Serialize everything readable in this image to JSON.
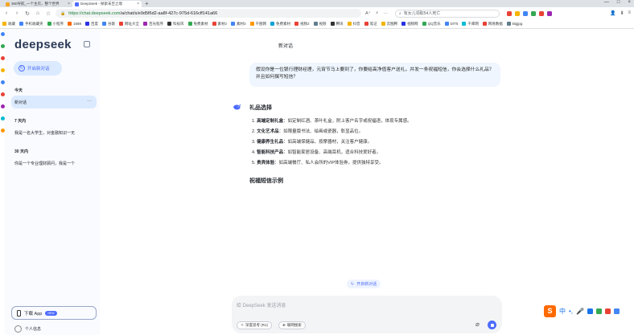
{
  "browser": {
    "tabs": [
      {
        "title": "360导航_一个主页，整个世界",
        "active": false,
        "color": "#f5a623"
      },
      {
        "title": "DeepSeek - 探索未至之境",
        "active": true,
        "color": "#4d6bfe"
      }
    ],
    "new_tab": "+",
    "window_controls": [
      "—",
      "□",
      "×"
    ],
    "nav": {
      "back": "‹",
      "forward": "›",
      "reload": "↻",
      "home": "⌂",
      "star": "☆"
    },
    "url": {
      "scheme": "https://",
      "host": "chat.deepseek.com",
      "path": "/a/chat/s/e9d5f6d2-aa8f-427c-975d-616cff141a66"
    },
    "url_tools": [
      "A⁺",
      "⚡",
      "⋯"
    ],
    "search_placeholder": "有女儿领取54人死亡",
    "bookmarks": [
      {
        "label": "收藏",
        "color": "#f4b400"
      },
      {
        "label": "手机收藏夹",
        "color": "#4285f4"
      },
      {
        "label": "小程序",
        "color": "#34a853"
      },
      {
        "label": "1688",
        "color": "#ff6a00"
      },
      {
        "label": "百度",
        "color": "#2932e1"
      },
      {
        "label": "谷歌",
        "color": "#4285f4"
      },
      {
        "label": "网址大全",
        "color": "#e94235"
      },
      {
        "label": "百光程序",
        "color": "#9c27b0"
      },
      {
        "label": "科技风",
        "color": "#333333"
      },
      {
        "label": "免费素材",
        "color": "#34a853"
      },
      {
        "label": "素材2",
        "color": "#e94235"
      },
      {
        "label": "素材3",
        "color": "#4285f4"
      },
      {
        "label": "千图网",
        "color": "#ff9800"
      },
      {
        "label": "免费素材",
        "color": "#00a1d6"
      },
      {
        "label": "视频2",
        "color": "#e94235"
      },
      {
        "label": "视频",
        "color": "#607d8b"
      },
      {
        "label": "腾讯",
        "color": "#333333"
      },
      {
        "label": "抖音",
        "color": "#f4b400"
      },
      {
        "label": "笔记",
        "color": "#e94235"
      },
      {
        "label": "云图腾",
        "color": "#f4b400"
      },
      {
        "label": "视频网",
        "color": "#2932e1"
      },
      {
        "label": "QQ音乐",
        "color": "#34a853"
      },
      {
        "label": "DIT5",
        "color": "#4285f4"
      },
      {
        "label": "千库网",
        "color": "#00bcd4"
      },
      {
        "label": "网易数据",
        "color": "#e94235"
      },
      {
        "label": "Bigjpg",
        "color": "#607d8b"
      }
    ]
  },
  "sidebar": {
    "logo": "deepseek",
    "new_chat": "开启新对话",
    "sections": [
      {
        "label": "今天",
        "items": [
          {
            "title": "新对话",
            "active": true
          }
        ]
      },
      {
        "label": "7 天内",
        "items": [
          {
            "title": "我是一名大学生，对金融知识一无",
            "active": false
          }
        ]
      },
      {
        "label": "30 天内",
        "items": [
          {
            "title": "你是一个专业理财顾问，我是一个",
            "active": false
          }
        ]
      }
    ],
    "download": {
      "label": "下载 App",
      "badge": "NEW"
    },
    "profile": {
      "label": "个人信息"
    }
  },
  "chat": {
    "title": "新对话",
    "user_message": "假设你是一位银行理财经理，元宵节马上要到了，你要给高净值客户送礼，并发一条祝福短信，你会选择什么礼品？并且如何撰写短信？",
    "ai_heading": "礼品选择",
    "gift_list": [
      {
        "num": "1.",
        "name": "高端定制礼盒",
        "desc": "：如定制红酒、茶叶礼盒，附上客户名字或祝福语，体现专属感。"
      },
      {
        "num": "2.",
        "name": "文化艺术品",
        "desc": "：如限量版书法、绘画或瓷器，彰显品位。"
      },
      {
        "num": "3.",
        "name": "健康养生礼品",
        "desc": "：如高端保健品、按摩器材，关注客户健康。"
      },
      {
        "num": "4.",
        "name": "智能科技产品",
        "desc": "：如智能家居设备、高端耳机，适合科技爱好者。"
      },
      {
        "num": "5.",
        "name": "贵宾体验",
        "desc": "：如高端餐厅、私人会所的VIP体验券，提供独特享受。"
      }
    ],
    "sms_heading": "祝福短信示例",
    "open_new_chat": "开启新对话"
  },
  "composer": {
    "placeholder": "给 DeepSeek 发送消息",
    "deep_think": "深度思考 (R1)",
    "web_search": "联网搜索"
  },
  "ime": {
    "lang": "中",
    "punct": "•,"
  }
}
